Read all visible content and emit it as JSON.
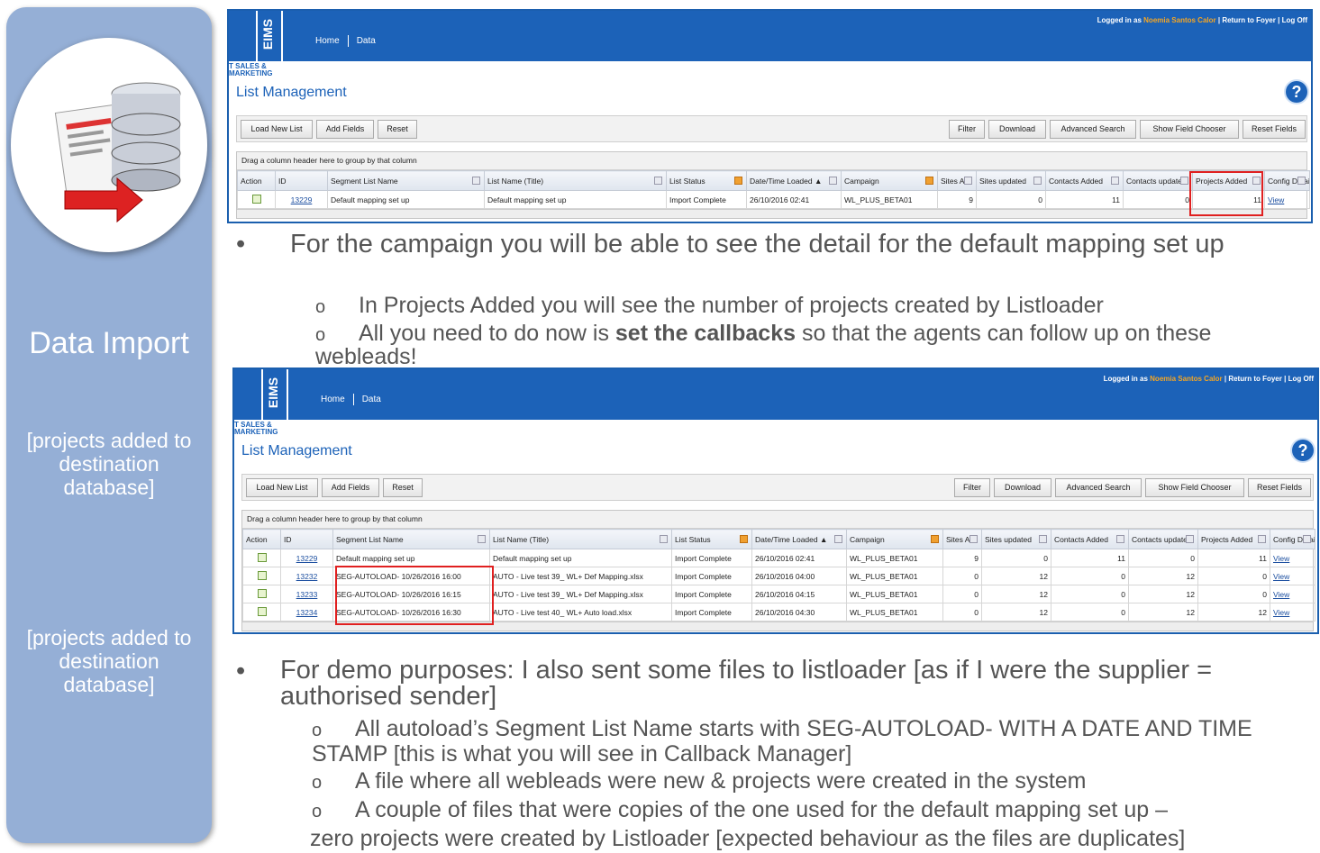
{
  "sidebar": {
    "title": "Data Import",
    "note1": [
      "[projects added to",
      "destination",
      "database]"
    ],
    "note2": [
      "[projects added to",
      "destination",
      "database]"
    ]
  },
  "app": {
    "logo": "EIMS",
    "tagline_line1": "T SALES &",
    "tagline_line2": "MARKETING",
    "nav": [
      "Home",
      "Data"
    ],
    "login_prefix": "Logged in as",
    "user": "Noemia Santos Calor",
    "return_link": "Return to Foyer",
    "logoff": "Log Off",
    "page_title": "List Management",
    "help": "?",
    "buttons_left": [
      "Load New List",
      "Add Fields",
      "Reset"
    ],
    "buttons_right": [
      "Filter",
      "Download",
      "Advanced Search",
      "Show Field Chooser",
      "Reset Fields"
    ],
    "group_hint": "Drag a column header here to group by that column",
    "columns": [
      "Action",
      "ID",
      "Segment List Name",
      "List Name (Title)",
      "List Status",
      "Date/Time Loaded",
      "Campaign",
      "Sites Adi",
      "Sites updated",
      "Contacts Added",
      "Contacts update",
      "Projects Added",
      "Config Detai"
    ],
    "sort_arrow": "▲",
    "view": "View"
  },
  "grid1": {
    "rows": [
      {
        "id": "13229",
        "segment": "Default mapping set up",
        "title": "Default mapping set up",
        "status": "Import Complete",
        "loaded": "26/10/2016 02:41",
        "campaign": "WL_PLUS_BETA01",
        "sites_added": "9",
        "sites_updated": "0",
        "contacts_added": "11",
        "contacts_updated": "0",
        "projects_added": "11"
      }
    ]
  },
  "grid2": {
    "rows": [
      {
        "id": "13229",
        "segment": "Default mapping set up",
        "title": "Default mapping set up",
        "status": "Import Complete",
        "loaded": "26/10/2016 02:41",
        "campaign": "WL_PLUS_BETA01",
        "sites_added": "9",
        "sites_updated": "0",
        "contacts_added": "11",
        "contacts_updated": "0",
        "projects_added": "11"
      },
      {
        "id": "13232",
        "segment": "SEG-AUTOLOAD- 10/26/2016 16:00",
        "title": "AUTO - Live test 39_ WL+ Def Mapping.xlsx",
        "status": "Import Complete",
        "loaded": "26/10/2016 04:00",
        "campaign": "WL_PLUS_BETA01",
        "sites_added": "0",
        "sites_updated": "12",
        "contacts_added": "0",
        "contacts_updated": "12",
        "projects_added": "0"
      },
      {
        "id": "13233",
        "segment": "SEG-AUTOLOAD- 10/26/2016 16:15",
        "title": "AUTO - Live test 39_ WL+ Def Mapping.xlsx",
        "status": "Import Complete",
        "loaded": "26/10/2016 04:15",
        "campaign": "WL_PLUS_BETA01",
        "sites_added": "0",
        "sites_updated": "12",
        "contacts_added": "0",
        "contacts_updated": "12",
        "projects_added": "0"
      },
      {
        "id": "13234",
        "segment": "SEG-AUTOLOAD- 10/26/2016 16:30",
        "title": "AUTO - Live test 40_ WL+ Auto load.xlsx",
        "status": "Import Complete",
        "loaded": "26/10/2016 04:30",
        "campaign": "WL_PLUS_BETA01",
        "sites_added": "0",
        "sites_updated": "12",
        "contacts_added": "0",
        "contacts_updated": "12",
        "projects_added": "12"
      }
    ]
  },
  "text": {
    "b1": "For the campaign you will be able to see the detail for the default mapping set up",
    "s1": "In Projects Added you will see the number of projects created by Listloader",
    "s2_pre": "All you need to do now is ",
    "s2_bold": "set the callbacks",
    "s2_post": " so that the agents can follow up on these webleads!",
    "b2": "For demo purposes: I also sent some files to listloader [as if I were the supplier = authorised sender]",
    "s3": "All autoload’s Segment List Name starts with SEG-AUTOLOAD- WITH A DATE AND TIME STAMP [this is what you will see in Callback Manager]",
    "s4": "A file where all webleads were new & projects were created in the system",
    "s5": "A couple of files that were copies of the one used for the default mapping set up –",
    "s5_cont": "zero projects were created by Listloader [expected behaviour as the files are duplicates]",
    "bullet_glyph": "•",
    "sub_glyph": "o"
  }
}
